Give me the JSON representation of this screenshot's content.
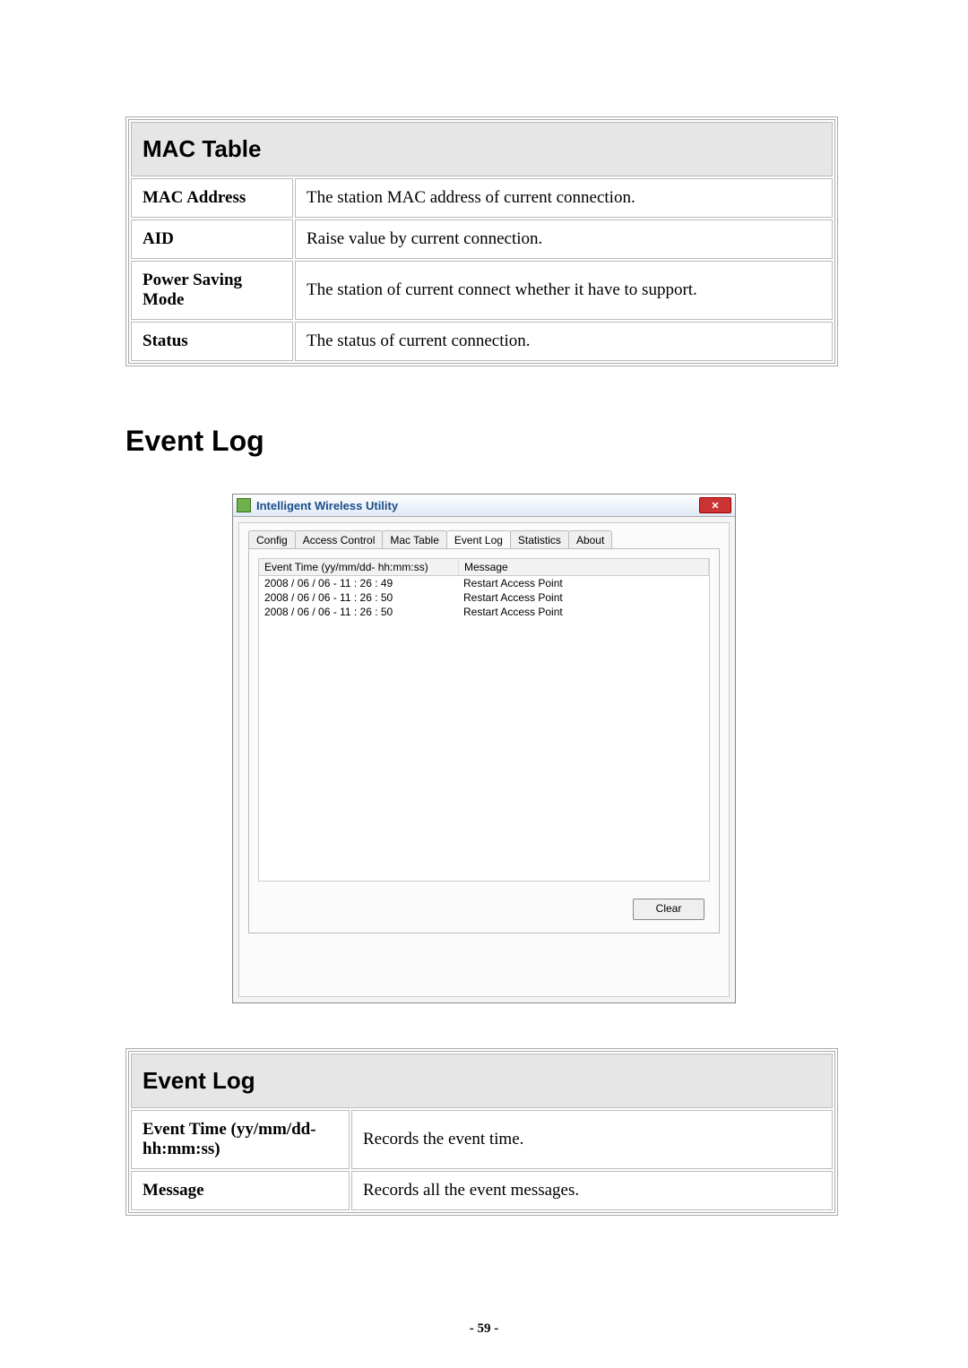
{
  "mac_table": {
    "title": "MAC Table",
    "rows": [
      {
        "label": "MAC Address",
        "desc": "The station MAC address of current connection."
      },
      {
        "label": "AID",
        "desc": "Raise value by current connection."
      },
      {
        "label": "Power Saving Mode",
        "desc": "The station of current connect whether it have to support."
      },
      {
        "label": "Status",
        "desc": "The status of current connection."
      }
    ]
  },
  "section_heading": "Event Log",
  "screenshot": {
    "window_title": "Intelligent Wireless Utility",
    "close_glyph": "✕",
    "tabs": [
      "Config",
      "Access Control",
      "Mac Table",
      "Event Log",
      "Statistics",
      "About"
    ],
    "active_tab_index": 3,
    "columns": {
      "time": "Event Time (yy/mm/dd- hh:mm:ss)",
      "msg": "Message"
    },
    "events": [
      {
        "time": "2008 / 06 / 06 - 11 : 26 : 49",
        "msg": "Restart Access Point"
      },
      {
        "time": "2008 / 06 / 06 - 11 : 26 : 50",
        "msg": "Restart Access Point"
      },
      {
        "time": "2008 / 06 / 06 - 11 : 26 : 50",
        "msg": "Restart Access Point"
      }
    ],
    "clear_label": "Clear"
  },
  "event_log_table": {
    "title": "Event Log",
    "rows": [
      {
        "label": "Event Time (yy/mm/dd-hh:mm:ss)",
        "desc": "Records the event time."
      },
      {
        "label": "Message",
        "desc": "Records all the event messages."
      }
    ]
  },
  "page_number": "- 59 -"
}
